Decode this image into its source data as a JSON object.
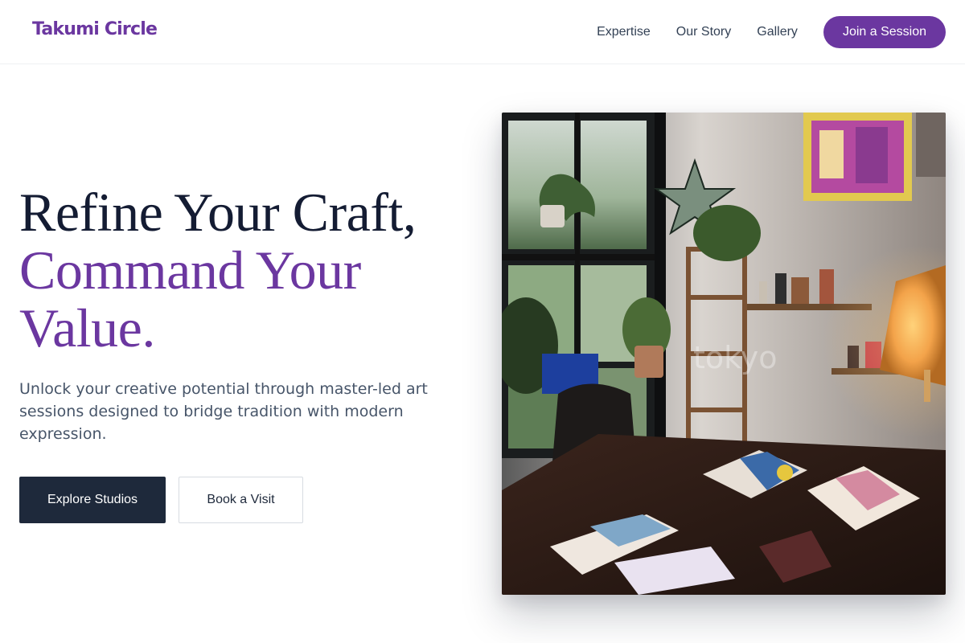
{
  "header": {
    "brand": "Takumi Circle",
    "nav": [
      "Expertise",
      "Our Story",
      "Gallery"
    ],
    "cta": "Join a Session"
  },
  "hero": {
    "title_line1": "Refine Your Craft,",
    "title_line2": "Command Your",
    "title_line3": "Value.",
    "subtitle": "Unlock your creative potential through master-led art sessions designed to bridge tradition with modern expression.",
    "primary_button": "Explore Studios",
    "secondary_button": "Book a Visit"
  },
  "image": {
    "watermark": "tokyo"
  },
  "colors": {
    "accent": "#6b37a0",
    "dark": "#1e293b",
    "title": "#141c33"
  }
}
